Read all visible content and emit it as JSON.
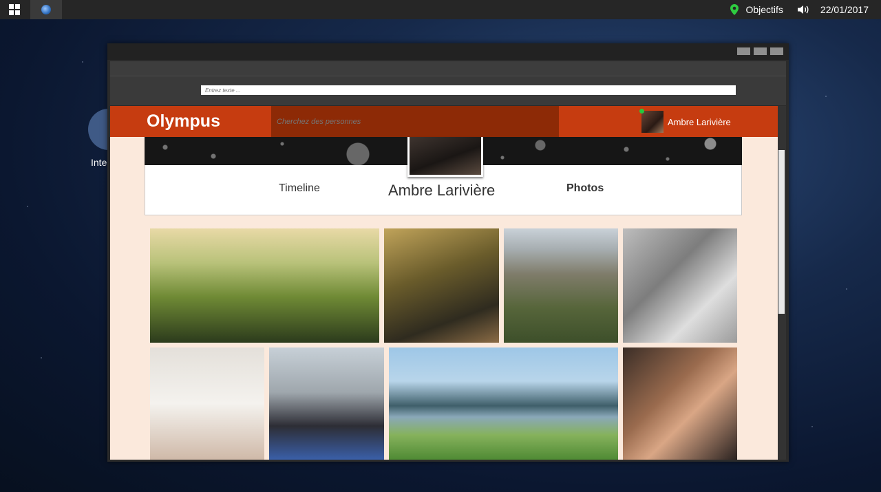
{
  "taskbar": {
    "objectives_label": "Objectifs",
    "date": "22/01/2017"
  },
  "desktop": {
    "icon_label": "Inte"
  },
  "browser": {
    "address_placeholder": "Entrez texte ..."
  },
  "site": {
    "logo": "Olympus",
    "search_placeholder": "Cherchez des personnes",
    "user_name": "Ambre Larivière",
    "user_status_color": "#25c93e",
    "accent_color": "#c63c10"
  },
  "profile": {
    "name": "Ambre Larivière",
    "tabs": [
      "Timeline",
      "Photos"
    ],
    "active_tab": "Photos"
  },
  "photos": {
    "count": 8
  }
}
